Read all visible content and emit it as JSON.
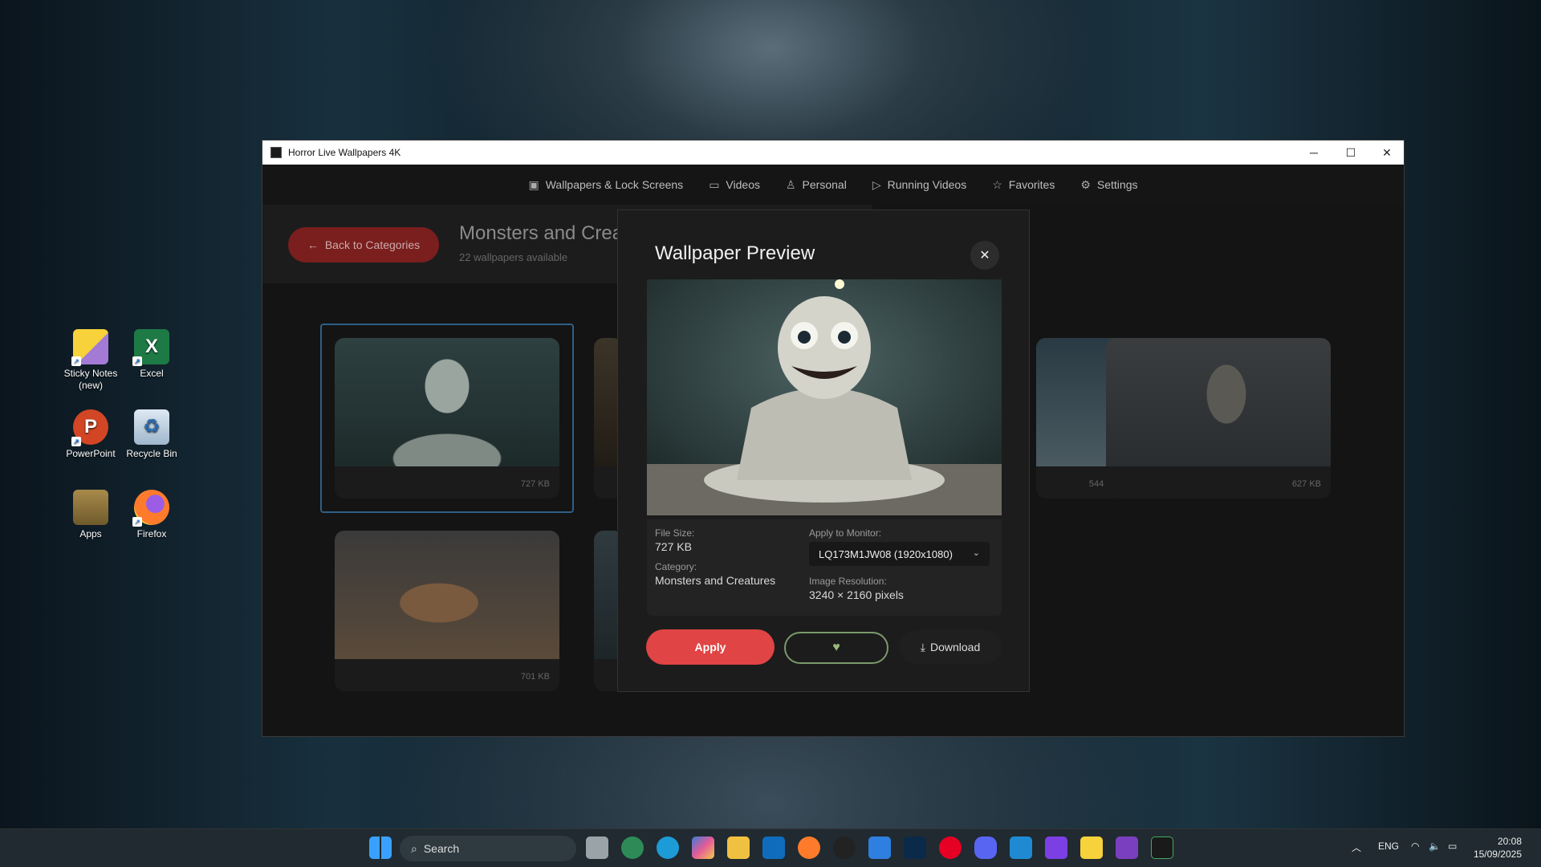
{
  "desktop": {
    "icons": [
      {
        "label": "Sticky Notes (new)",
        "icon": "sticky-notes-icon"
      },
      {
        "label": "Excel",
        "icon": "excel-icon"
      },
      {
        "label": "PowerPoint",
        "icon": "powerpoint-icon"
      },
      {
        "label": "Recycle Bin",
        "icon": "recycle-bin-icon"
      },
      {
        "label": "Apps",
        "icon": "folder-icon"
      },
      {
        "label": "Firefox",
        "icon": "firefox-icon"
      }
    ]
  },
  "window": {
    "title": "Horror Live Wallpapers 4K",
    "controls": {
      "minimize": "─",
      "maximize": "☐",
      "close": "✕"
    }
  },
  "nav": {
    "items": [
      {
        "label": "Wallpapers & Lock Screens",
        "icon": "image-icon"
      },
      {
        "label": "Videos",
        "icon": "video-icon"
      },
      {
        "label": "Personal",
        "icon": "user-icon"
      },
      {
        "label": "Running Videos",
        "icon": "play-icon"
      },
      {
        "label": "Favorites",
        "icon": "star-icon"
      },
      {
        "label": "Settings",
        "icon": "gear-icon"
      }
    ]
  },
  "category": {
    "back_label": "Back to Categories",
    "title": "Monsters and Creatures",
    "subtitle": "22 wallpapers available"
  },
  "grid": {
    "cards": [
      {
        "size": "727 KB"
      },
      {
        "size": "544 KB"
      },
      {
        "size": "627 KB"
      },
      {
        "size": "701 KB"
      }
    ]
  },
  "modal": {
    "title": "Wallpaper Preview",
    "file_size_label": "File Size:",
    "file_size": "727 KB",
    "category_label": "Category:",
    "category": "Monsters and Creatures",
    "monitor_label": "Apply to Monitor:",
    "monitor_value": "LQ173M1JW08 (1920x1080)",
    "resolution_label": "Image Resolution:",
    "resolution": "3240 × 2160 pixels",
    "apply_label": "Apply",
    "download_label": "Download"
  },
  "taskbar": {
    "search_placeholder": "Search",
    "lang": "ENG",
    "time": "20:08",
    "date": "15/09/2025"
  },
  "colors": {
    "accent_red": "#e04444",
    "favorite_green": "#7a9a6a",
    "selection_blue": "#2f5f86"
  }
}
